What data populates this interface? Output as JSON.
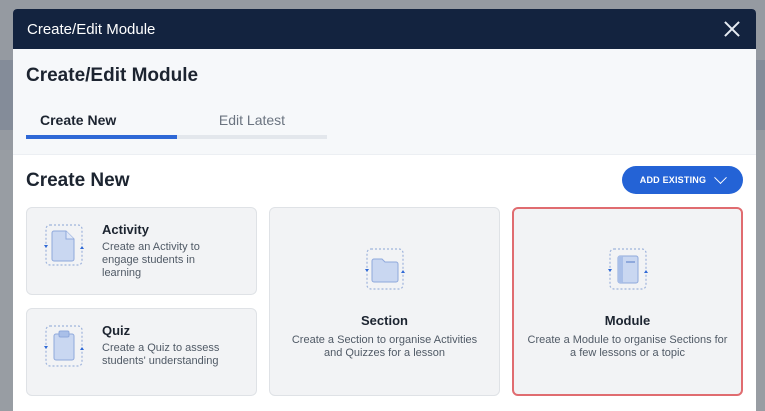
{
  "modal": {
    "title": "Create/Edit Module",
    "heading": "Create/Edit Module",
    "tabs": [
      {
        "label": "Create New",
        "active": true
      },
      {
        "label": "Edit Latest",
        "active": false
      }
    ],
    "section_heading": "Create New",
    "add_existing_label": "ADD EXISTING",
    "options": [
      {
        "name": "Activity",
        "description": "Create an Activity to engage students in learning",
        "icon": "document-icon"
      },
      {
        "name": "Quiz",
        "description": "Create a Quiz to assess students' understanding",
        "icon": "clipboard-icon"
      },
      {
        "name": "Section",
        "description": "Create a Section to organise Activities and Quizzes for a lesson",
        "icon": "folder-icon"
      },
      {
        "name": "Module",
        "description": "Create a Module to organise Sections for a few lessons or a topic",
        "icon": "notebook-icon",
        "selected": true
      }
    ]
  },
  "colors": {
    "header_bg": "#13233f",
    "accent": "#2463d6",
    "selected_border": "#e06c70"
  }
}
